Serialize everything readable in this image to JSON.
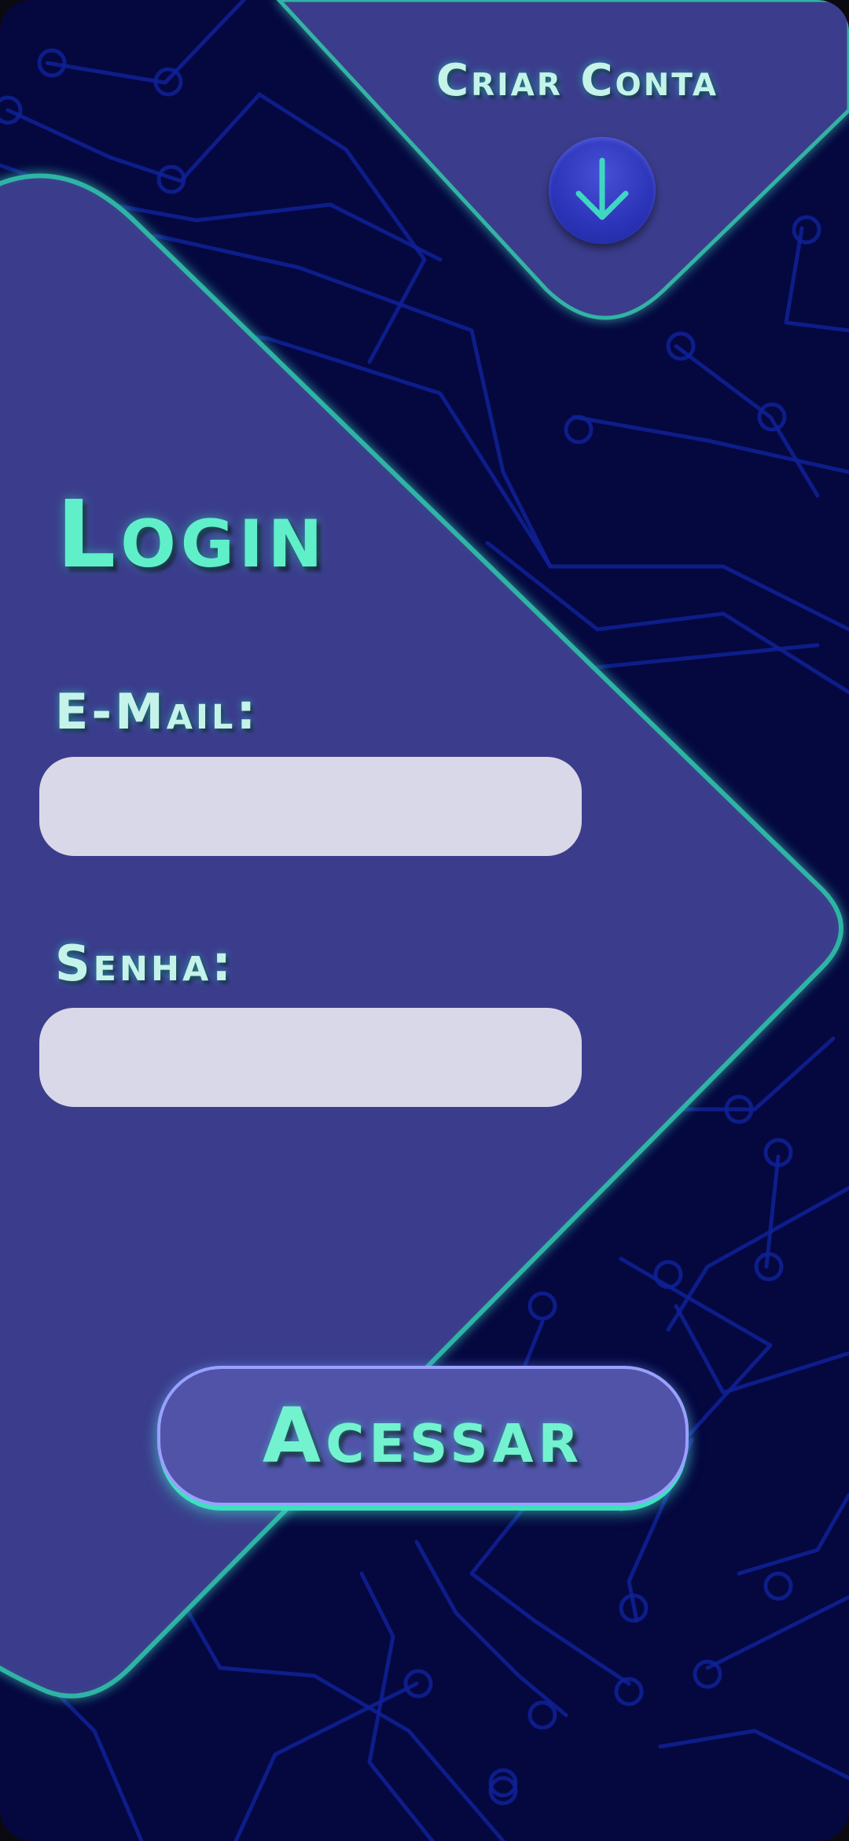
{
  "header": {
    "create_account_label": "Criar Conta",
    "arrow_icon": "arrow-down-icon"
  },
  "login": {
    "title": "Login",
    "email_label": "E-Mail:",
    "email_value": "",
    "password_label": "Senha:",
    "password_value": "",
    "submit_label": "Acessar"
  },
  "colors": {
    "background": "#05073f",
    "panel": "#3a3c8c",
    "accent": "#3de1be",
    "input": "#d9d8e8",
    "button": "#5053a8"
  }
}
